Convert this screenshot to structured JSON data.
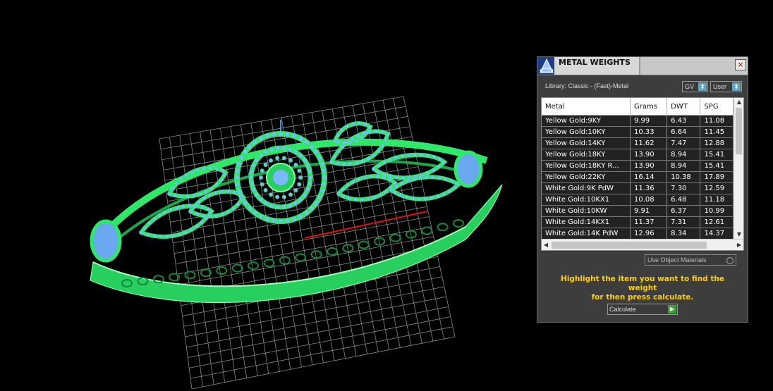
{
  "panel": {
    "title": "METAL WEIGHTS",
    "close_label": "×",
    "library_label": "Library: Classic - (Fast)-Metal",
    "gv_combo": "GV",
    "user_combo": "User",
    "combo_icon": "dropdown-arrow-icon",
    "table": {
      "columns": [
        "Metal",
        "Grams",
        "DWT",
        "SPG"
      ],
      "rows": [
        [
          "Yellow Gold:9KY",
          "9.99",
          "6.43",
          "11.08"
        ],
        [
          "Yellow Gold:10KY",
          "10.33",
          "6.64",
          "11.45"
        ],
        [
          "Yellow Gold:14KY",
          "11.62",
          "7.47",
          "12.88"
        ],
        [
          "Yellow Gold:18KY",
          "13.90",
          "8.94",
          "15.41"
        ],
        [
          "Yellow Gold:18KY R...",
          "13.90",
          "8.94",
          "15.41"
        ],
        [
          "Yellow Gold:22KY",
          "16.14",
          "10.38",
          "17.89"
        ],
        [
          "White Gold:9K PdW",
          "11.36",
          "7.30",
          "12.59"
        ],
        [
          "White Gold:10KX1",
          "10.08",
          "6.48",
          "11.18"
        ],
        [
          "White Gold:10KW",
          "9.91",
          "6.37",
          "10.99"
        ],
        [
          "White Gold:14KX1",
          "11.37",
          "7.31",
          "12.61"
        ],
        [
          "White Gold:14K PdW",
          "12.96",
          "8.34",
          "14.37"
        ]
      ]
    },
    "use_object_materials": "Use Object Materials",
    "instruction_line1": "Highlight the item you want to find the weight",
    "instruction_line2": "for then press calculate.",
    "calculate_label": "Calculate",
    "calculate_icon": "play-icon"
  },
  "colors": {
    "model_green": "#2ee86a",
    "gem_blue": "#7ab8ff",
    "grid": "#8a8a8a",
    "instruction_yellow": "#ffd100",
    "axis_red": "#e01010"
  }
}
